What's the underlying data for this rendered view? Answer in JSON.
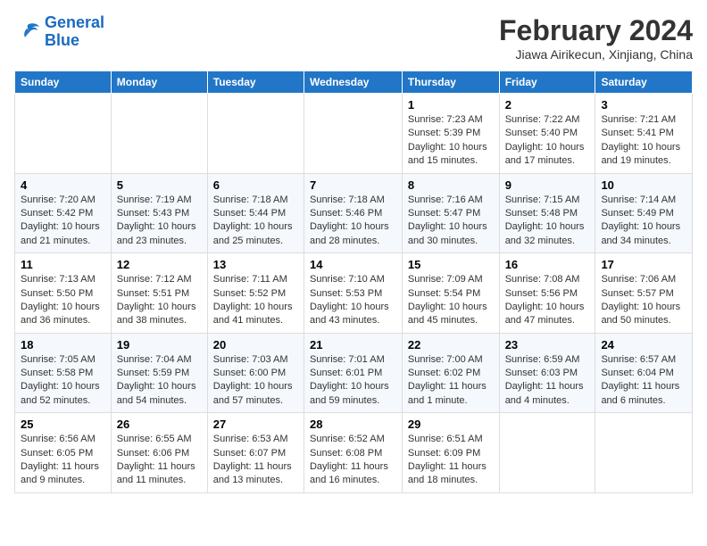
{
  "header": {
    "logo_line1": "General",
    "logo_line2": "Blue",
    "month_title": "February 2024",
    "location": "Jiawa Airikecun, Xinjiang, China"
  },
  "days_of_week": [
    "Sunday",
    "Monday",
    "Tuesday",
    "Wednesday",
    "Thursday",
    "Friday",
    "Saturday"
  ],
  "weeks": [
    [
      {
        "day": "",
        "info": ""
      },
      {
        "day": "",
        "info": ""
      },
      {
        "day": "",
        "info": ""
      },
      {
        "day": "",
        "info": ""
      },
      {
        "day": "1",
        "info": "Sunrise: 7:23 AM\nSunset: 5:39 PM\nDaylight: 10 hours and 15 minutes."
      },
      {
        "day": "2",
        "info": "Sunrise: 7:22 AM\nSunset: 5:40 PM\nDaylight: 10 hours and 17 minutes."
      },
      {
        "day": "3",
        "info": "Sunrise: 7:21 AM\nSunset: 5:41 PM\nDaylight: 10 hours and 19 minutes."
      }
    ],
    [
      {
        "day": "4",
        "info": "Sunrise: 7:20 AM\nSunset: 5:42 PM\nDaylight: 10 hours and 21 minutes."
      },
      {
        "day": "5",
        "info": "Sunrise: 7:19 AM\nSunset: 5:43 PM\nDaylight: 10 hours and 23 minutes."
      },
      {
        "day": "6",
        "info": "Sunrise: 7:18 AM\nSunset: 5:44 PM\nDaylight: 10 hours and 25 minutes."
      },
      {
        "day": "7",
        "info": "Sunrise: 7:18 AM\nSunset: 5:46 PM\nDaylight: 10 hours and 28 minutes."
      },
      {
        "day": "8",
        "info": "Sunrise: 7:16 AM\nSunset: 5:47 PM\nDaylight: 10 hours and 30 minutes."
      },
      {
        "day": "9",
        "info": "Sunrise: 7:15 AM\nSunset: 5:48 PM\nDaylight: 10 hours and 32 minutes."
      },
      {
        "day": "10",
        "info": "Sunrise: 7:14 AM\nSunset: 5:49 PM\nDaylight: 10 hours and 34 minutes."
      }
    ],
    [
      {
        "day": "11",
        "info": "Sunrise: 7:13 AM\nSunset: 5:50 PM\nDaylight: 10 hours and 36 minutes."
      },
      {
        "day": "12",
        "info": "Sunrise: 7:12 AM\nSunset: 5:51 PM\nDaylight: 10 hours and 38 minutes."
      },
      {
        "day": "13",
        "info": "Sunrise: 7:11 AM\nSunset: 5:52 PM\nDaylight: 10 hours and 41 minutes."
      },
      {
        "day": "14",
        "info": "Sunrise: 7:10 AM\nSunset: 5:53 PM\nDaylight: 10 hours and 43 minutes."
      },
      {
        "day": "15",
        "info": "Sunrise: 7:09 AM\nSunset: 5:54 PM\nDaylight: 10 hours and 45 minutes."
      },
      {
        "day": "16",
        "info": "Sunrise: 7:08 AM\nSunset: 5:56 PM\nDaylight: 10 hours and 47 minutes."
      },
      {
        "day": "17",
        "info": "Sunrise: 7:06 AM\nSunset: 5:57 PM\nDaylight: 10 hours and 50 minutes."
      }
    ],
    [
      {
        "day": "18",
        "info": "Sunrise: 7:05 AM\nSunset: 5:58 PM\nDaylight: 10 hours and 52 minutes."
      },
      {
        "day": "19",
        "info": "Sunrise: 7:04 AM\nSunset: 5:59 PM\nDaylight: 10 hours and 54 minutes."
      },
      {
        "day": "20",
        "info": "Sunrise: 7:03 AM\nSunset: 6:00 PM\nDaylight: 10 hours and 57 minutes."
      },
      {
        "day": "21",
        "info": "Sunrise: 7:01 AM\nSunset: 6:01 PM\nDaylight: 10 hours and 59 minutes."
      },
      {
        "day": "22",
        "info": "Sunrise: 7:00 AM\nSunset: 6:02 PM\nDaylight: 11 hours and 1 minute."
      },
      {
        "day": "23",
        "info": "Sunrise: 6:59 AM\nSunset: 6:03 PM\nDaylight: 11 hours and 4 minutes."
      },
      {
        "day": "24",
        "info": "Sunrise: 6:57 AM\nSunset: 6:04 PM\nDaylight: 11 hours and 6 minutes."
      }
    ],
    [
      {
        "day": "25",
        "info": "Sunrise: 6:56 AM\nSunset: 6:05 PM\nDaylight: 11 hours and 9 minutes."
      },
      {
        "day": "26",
        "info": "Sunrise: 6:55 AM\nSunset: 6:06 PM\nDaylight: 11 hours and 11 minutes."
      },
      {
        "day": "27",
        "info": "Sunrise: 6:53 AM\nSunset: 6:07 PM\nDaylight: 11 hours and 13 minutes."
      },
      {
        "day": "28",
        "info": "Sunrise: 6:52 AM\nSunset: 6:08 PM\nDaylight: 11 hours and 16 minutes."
      },
      {
        "day": "29",
        "info": "Sunrise: 6:51 AM\nSunset: 6:09 PM\nDaylight: 11 hours and 18 minutes."
      },
      {
        "day": "",
        "info": ""
      },
      {
        "day": "",
        "info": ""
      }
    ]
  ]
}
